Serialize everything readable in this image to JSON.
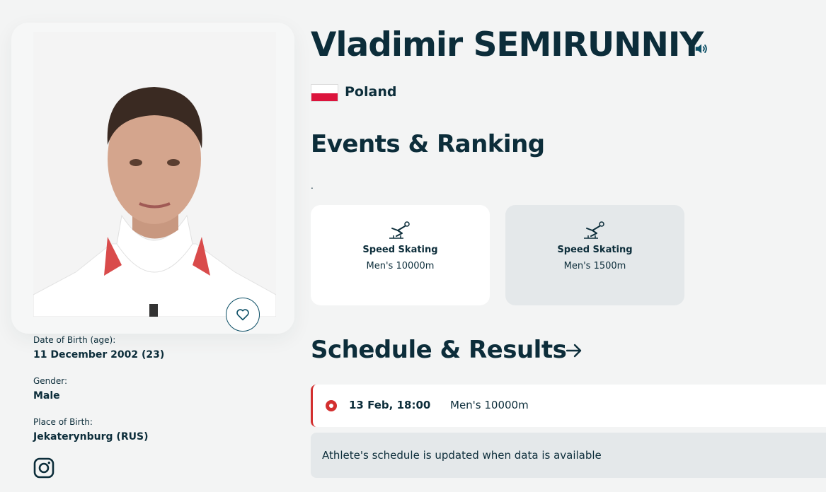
{
  "athlete": {
    "name": "Vladimir SEMIRUNNIY",
    "country": "Poland",
    "flag_colors": [
      "#ffffff",
      "#dc143c"
    ],
    "photo_description": "athlete portrait"
  },
  "info": {
    "dob_label": "Date of Birth (age):",
    "dob_value": "11 December 2002 (23)",
    "gender_label": "Gender:",
    "gender_value": "Male",
    "pob_label": "Place of Birth:",
    "pob_value": "Jekaterynburg (RUS)"
  },
  "icons": {
    "favorite": "heart-icon",
    "social": "instagram-icon",
    "pronounce": "speaker-icon",
    "sport": "speed-skating-icon",
    "more": "arrow-right-icon",
    "status": "live-dot-icon"
  },
  "events_section": {
    "title": "Events & Ranking",
    "note": ".",
    "cards": [
      {
        "sport": "Speed Skating",
        "event": "Men's 10000m"
      },
      {
        "sport": "Speed Skating",
        "event": "Men's 1500m"
      }
    ]
  },
  "schedule_section": {
    "title": "Schedule & Results",
    "rows": [
      {
        "time": "13 Feb, 18:00",
        "event": "Men's 10000m"
      }
    ],
    "notice": "Athlete's schedule is updated when data is available"
  },
  "colors": {
    "primary": "#0c2d3a",
    "accent_red": "#d32f2f",
    "background": "#f3f4f4",
    "card_selected": "#e4e8ea"
  }
}
